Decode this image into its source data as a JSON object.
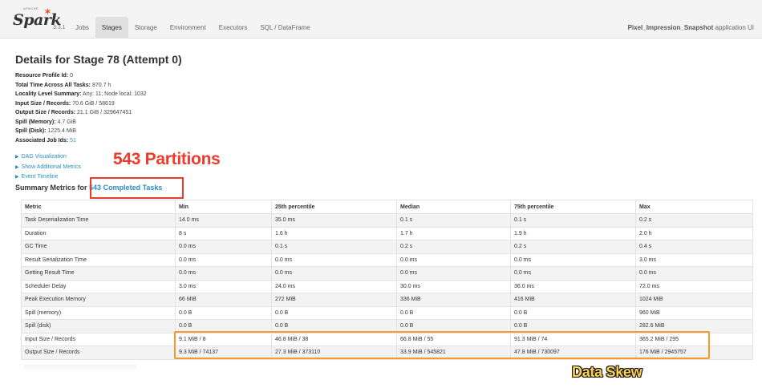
{
  "nav": {
    "logo_word": "Spark",
    "logo_apache": "APACHE",
    "version": "3.3.1",
    "tabs": [
      {
        "label": "Jobs",
        "active": false
      },
      {
        "label": "Stages",
        "active": true
      },
      {
        "label": "Storage",
        "active": false
      },
      {
        "label": "Environment",
        "active": false
      },
      {
        "label": "Executors",
        "active": false
      },
      {
        "label": "SQL / DataFrame",
        "active": false
      }
    ],
    "app_name": "Pixel_Impression_Snapshot",
    "app_suffix": "application UI"
  },
  "page": {
    "title": "Details for Stage 78 (Attempt 0)",
    "summary": [
      {
        "key": "Resource Profile Id:",
        "value": "0"
      },
      {
        "key": "Total Time Across All Tasks:",
        "value": "870.7 h"
      },
      {
        "key": "Locality Level Summary:",
        "value": "Any: 11; Node local: 1032"
      },
      {
        "key": "Input Size / Records:",
        "value": "70.6 GiB / 58619"
      },
      {
        "key": "Output Size / Records:",
        "value": "21.1 GiB / 329647451"
      },
      {
        "key": "Spill (Memory):",
        "value": "4.7 GiB"
      },
      {
        "key": "Spill (Disk):",
        "value": "1225.4 MiB"
      },
      {
        "key": "Associated Job Ids:",
        "value": "51"
      }
    ],
    "links": [
      "DAG Visualization",
      "Show Additional Metrics",
      "Event Timeline"
    ],
    "metrics_heading_prefix": "Summary Metrics for",
    "metrics_heading_link": "543 Completed Tasks"
  },
  "annotations": {
    "partitions": "543 Partitions",
    "skew": "Data Skew",
    "partitions_color": "#ee3b2b",
    "skew_color": "#f39c2a"
  },
  "metrics_table": {
    "headers": [
      "Metric",
      "Min",
      "25th percentile",
      "Median",
      "75th percentile",
      "Max"
    ],
    "rows": [
      [
        "Task Deserialization Time",
        "14.0 ms",
        "35.0 ms",
        "0.1 s",
        "0.1 s",
        "0.2 s"
      ],
      [
        "Duration",
        "8 s",
        "1.6 h",
        "1.7 h",
        "1.9 h",
        "2.0 h"
      ],
      [
        "GC Time",
        "0.0 ms",
        "0.1 s",
        "0.2 s",
        "0.2 s",
        "0.4 s"
      ],
      [
        "Result Serialization Time",
        "0.0 ms",
        "0.0 ms",
        "0.0 ms",
        "0.0 ms",
        "3.0 ms"
      ],
      [
        "Getting Result Time",
        "0.0 ms",
        "0.0 ms",
        "0.0 ms",
        "0.0 ms",
        "0.0 ms"
      ],
      [
        "Scheduler Delay",
        "3.0 ms",
        "24.0 ms",
        "30.0 ms",
        "36.0 ms",
        "72.0 ms"
      ],
      [
        "Peak Execution Memory",
        "66 MiB",
        "272 MiB",
        "336 MiB",
        "416 MiB",
        "1024 MiB"
      ],
      [
        "Spill (memory)",
        "0.0 B",
        "0.0 B",
        "0.0 B",
        "0.0 B",
        "960 MiB"
      ],
      [
        "Spill (disk)",
        "0.0 B",
        "0.0 B",
        "0.0 B",
        "0.0 B",
        "282.6 MiB"
      ],
      [
        "Input Size / Records",
        "9.1 MiB / 8",
        "46.8 MiB / 38",
        "66.8 MiB / 55",
        "91.3 MiB / 74",
        "365.2 MiB / 295"
      ],
      [
        "Output Size / Records",
        "9.3 MiB / 74137",
        "27.3 MiB / 373110",
        "33.9 MiB / 545821",
        "47.8 MiB / 730097",
        "176 MiB / 2945757"
      ]
    ]
  }
}
